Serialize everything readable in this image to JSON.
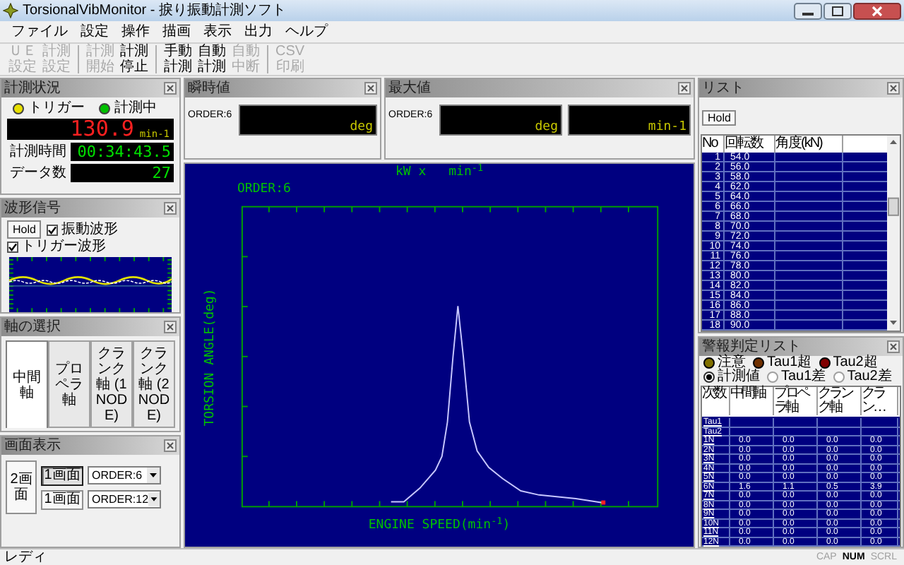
{
  "window": {
    "title": "TorsionalVibMonitor - 捩り振動計測ソフト"
  },
  "menu": [
    "ファイル",
    "設定",
    "操作",
    "描画",
    "表示",
    "出力",
    "ヘルプ"
  ],
  "toolbar": [
    [
      {
        "lines": [
          "ＵＥ",
          "設定"
        ],
        "disabled": true
      },
      {
        "lines": [
          "計測",
          "設定"
        ],
        "disabled": true
      }
    ],
    [
      {
        "lines": [
          "計測",
          "開始"
        ],
        "disabled": true
      },
      {
        "lines": [
          "計測",
          "停止"
        ],
        "disabled": false
      }
    ],
    [
      {
        "lines": [
          "手動",
          "計測"
        ],
        "disabled": false
      },
      {
        "lines": [
          "自動",
          "計測"
        ],
        "disabled": false
      },
      {
        "lines": [
          "自動",
          "中断"
        ],
        "disabled": true
      }
    ],
    [
      {
        "lines": [
          "CSV",
          "印刷"
        ],
        "disabled": true
      }
    ]
  ],
  "status_panel": {
    "title": "計測状況",
    "indicators": [
      {
        "label": "トリガー",
        "color": "#e8e000"
      },
      {
        "label": "計測中",
        "color": "#00c000"
      }
    ],
    "speed": {
      "value": "130.9",
      "unit": "min-1"
    },
    "fields": [
      {
        "label": "計測時間",
        "value": "00:34:43.5"
      },
      {
        "label": "データ数",
        "value": "27"
      }
    ]
  },
  "waveform_panel": {
    "title": "波形信号",
    "hold": "Hold",
    "checks": [
      {
        "label": "振動波形",
        "checked": true
      },
      {
        "label": "トリガー波形",
        "checked": true
      }
    ]
  },
  "axis_panel": {
    "title": "軸の選択",
    "tabs": [
      {
        "label": "中間軸",
        "selected": true
      },
      {
        "label": "プロペラ軸",
        "selected": false
      },
      {
        "label": "クランク軸 (1NODE)",
        "selected": false
      },
      {
        "label": "クランク軸 (2NODE)",
        "selected": false
      }
    ]
  },
  "display_panel": {
    "title": "画面表示",
    "main_button": "2画面",
    "rows": [
      {
        "button": "1画面",
        "selected": true,
        "order": "ORDER:6"
      },
      {
        "button": "1画面",
        "selected": false,
        "order": "ORDER:12"
      }
    ]
  },
  "instant_panel": {
    "title": "瞬時値",
    "order": "ORDER:6",
    "units": [
      "deg"
    ]
  },
  "max_panel": {
    "title": "最大値",
    "order": "ORDER:6",
    "units": [
      "deg",
      "min-1"
    ]
  },
  "chart": {
    "top_label": "kW x",
    "top_unit": "min$^{-1}$",
    "order": "ORDER:6",
    "ylabel": "TORSION ANGLE(deg)",
    "xlabel": "ENGINE SPEED(min$^{-1}$)"
  },
  "list_panel": {
    "title": "リスト",
    "hold": "Hold",
    "columns": [
      "No",
      "回転数",
      "角度(kN)"
    ],
    "rows": [
      {
        "no": "1",
        "speed": "54.0"
      },
      {
        "no": "2",
        "speed": "56.0"
      },
      {
        "no": "3",
        "speed": "58.0"
      },
      {
        "no": "4",
        "speed": "62.0"
      },
      {
        "no": "5",
        "speed": "64.0"
      },
      {
        "no": "6",
        "speed": "66.0"
      },
      {
        "no": "7",
        "speed": "68.0"
      },
      {
        "no": "8",
        "speed": "70.0"
      },
      {
        "no": "9",
        "speed": "72.0"
      },
      {
        "no": "10",
        "speed": "74.0"
      },
      {
        "no": "11",
        "speed": "76.0"
      },
      {
        "no": "12",
        "speed": "78.0"
      },
      {
        "no": "13",
        "speed": "80.0"
      },
      {
        "no": "14",
        "speed": "82.0"
      },
      {
        "no": "15",
        "speed": "84.0"
      },
      {
        "no": "16",
        "speed": "86.0"
      },
      {
        "no": "17",
        "speed": "88.0"
      },
      {
        "no": "18",
        "speed": "90.0"
      }
    ]
  },
  "alarm_panel": {
    "title": "警報判定リスト",
    "legend": [
      {
        "label": "注意",
        "color": "#807000"
      },
      {
        "label": "Tau1超",
        "color": "#703000"
      },
      {
        "label": "Tau2超",
        "color": "#800000"
      }
    ],
    "radios": [
      {
        "label": "計測値",
        "selected": true
      },
      {
        "label": "Tau1差",
        "selected": false
      },
      {
        "label": "Tau2差",
        "selected": false
      }
    ],
    "columns": [
      "次数",
      "中間軸",
      "プロペラ軸",
      "クランク軸",
      "クラン…"
    ],
    "rows": [
      {
        "order": "Tau1"
      },
      {
        "order": "Tau2"
      },
      {
        "order": "1N",
        "values": [
          "0.0",
          "0.0",
          "0.0",
          "0.0"
        ]
      },
      {
        "order": "2N",
        "values": [
          "0.0",
          "0.0",
          "0.0",
          "0.0"
        ]
      },
      {
        "order": "3N",
        "values": [
          "0.0",
          "0.0",
          "0.0",
          "0.0"
        ]
      },
      {
        "order": "4N",
        "values": [
          "0.0",
          "0.0",
          "0.0",
          "0.0"
        ]
      },
      {
        "order": "5N",
        "values": [
          "0.0",
          "0.0",
          "0.0",
          "0.0"
        ]
      },
      {
        "order": "6N",
        "values": [
          "1.6",
          "1.1",
          "0.5",
          "3.9"
        ]
      },
      {
        "order": "7N",
        "values": [
          "0.0",
          "0.0",
          "0.0",
          "0.0"
        ]
      },
      {
        "order": "8N",
        "values": [
          "0.0",
          "0.0",
          "0.0",
          "0.0"
        ]
      },
      {
        "order": "9N",
        "values": [
          "0.0",
          "0.0",
          "0.0",
          "0.0"
        ]
      },
      {
        "order": "10N",
        "values": [
          "0.0",
          "0.0",
          "0.0",
          "0.0"
        ]
      },
      {
        "order": "11N",
        "values": [
          "0.0",
          "0.0",
          "0.0",
          "0.0"
        ]
      },
      {
        "order": "12N",
        "values": [
          "0.0",
          "0.0",
          "0.0",
          "0.0"
        ]
      }
    ]
  },
  "status_bar": {
    "text": "レディ",
    "indicators": [
      {
        "label": "CAP",
        "on": false
      },
      {
        "label": "NUM",
        "on": true
      },
      {
        "label": "SCRL",
        "on": false
      }
    ]
  }
}
